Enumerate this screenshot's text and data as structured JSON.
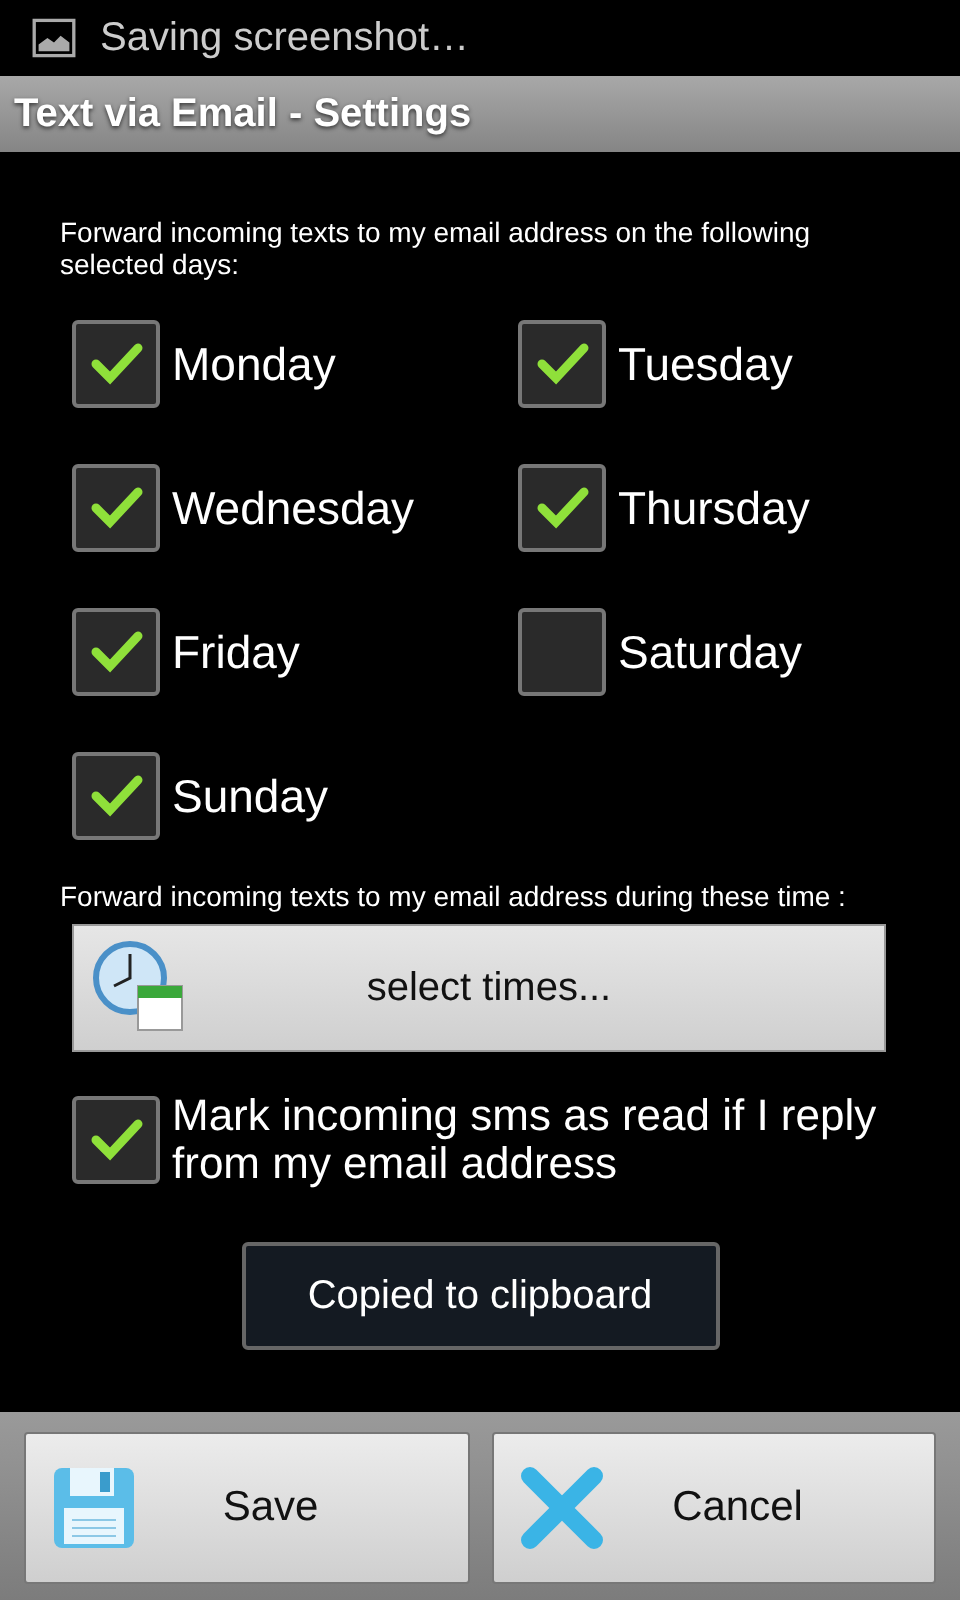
{
  "status_bar": {
    "notification": "Saving screenshot…"
  },
  "window": {
    "title": "Text via Email - Settings"
  },
  "days_label": "Forward incoming texts to my email address on the following selected days:",
  "days": [
    {
      "label": "Monday",
      "checked": true
    },
    {
      "label": "Tuesday",
      "checked": true
    },
    {
      "label": "Wednesday",
      "checked": true
    },
    {
      "label": "Thursday",
      "checked": true
    },
    {
      "label": "Friday",
      "checked": true
    },
    {
      "label": "Saturday",
      "checked": false
    },
    {
      "label": "Sunday",
      "checked": true
    }
  ],
  "times_label": "Forward incoming texts to my email address during these time :",
  "times_button": "select times...",
  "mark_read": {
    "label": "Mark incoming sms as read if I reply from my email address",
    "checked": true
  },
  "toast": "Copied to clipboard",
  "buttons": [
    {
      "kind": "save",
      "label": "Save"
    },
    {
      "kind": "cancel",
      "label": "Cancel"
    }
  ]
}
